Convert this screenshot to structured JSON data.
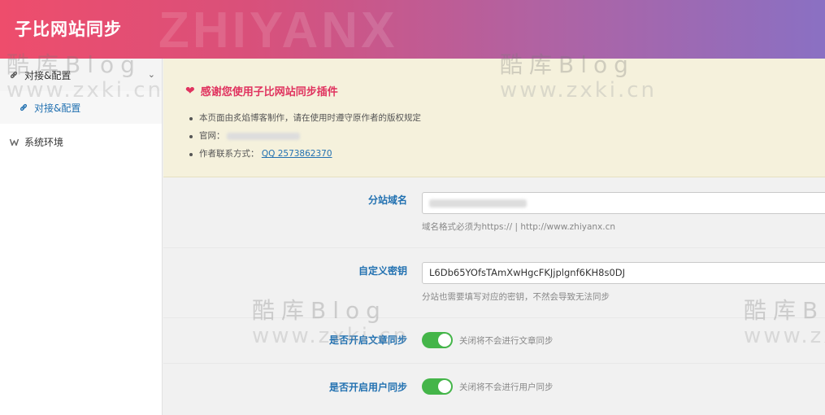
{
  "header": {
    "title": "子比网站同步",
    "watermark": "ZHIYANX"
  },
  "sidebar": {
    "items": [
      {
        "label": "对接&配置",
        "icon": "link-icon"
      },
      {
        "label": "对接&配置",
        "icon": "link-icon"
      },
      {
        "label": "系统环境",
        "icon": "wordpress-icon"
      }
    ]
  },
  "notice": {
    "title": "感谢您使用子比网站同步插件",
    "items": [
      "本页面由炙焰博客制作，请在使用时遵守原作者的版权规定",
      "官网：",
      "作者联系方式："
    ],
    "contact_link": "QQ 2573862370"
  },
  "settings": {
    "domain": {
      "label": "分站域名",
      "value": "",
      "hint": "域名格式必须为https:// | http://www.zhiyanx.cn"
    },
    "secret": {
      "label": "自定义密钥",
      "value": "L6Db65YOfsTAmXwHgcFKJjplgnf6KH8s0DJ",
      "hint": "分站也需要填写对应的密钥，不然会导致无法同步"
    },
    "article_sync": {
      "label": "是否开启文章同步",
      "enabled": true,
      "hint": "关闭将不会进行文章同步"
    },
    "user_sync": {
      "label": "是否开启用户同步",
      "enabled": true,
      "hint": "关闭将不会进行用户同步"
    }
  },
  "watermarks": {
    "cn": "酷库Blog",
    "url": "www.zxki.cn"
  },
  "colors": {
    "accent": "#2271b1",
    "heart": "#e0335f",
    "toggle": "#44b549",
    "notice_bg": "#f5f1dc"
  }
}
